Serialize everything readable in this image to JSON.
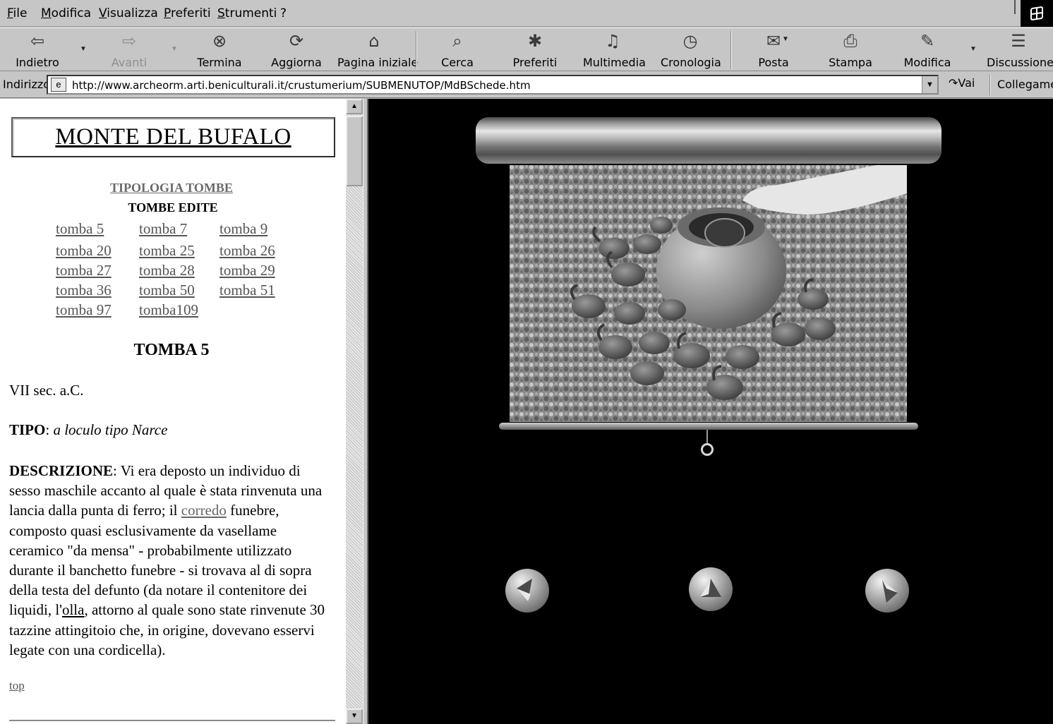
{
  "browser": {
    "menu": [
      "File",
      "Modifica",
      "Visualizza",
      "Preferiti",
      "Strumenti",
      "?"
    ],
    "toolbar": {
      "back": "Indietro",
      "forward": "Avanti",
      "stop": "Termina",
      "refresh": "Aggiorna",
      "home": "Pagina iniziale",
      "search": "Cerca",
      "favorites": "Preferiti",
      "media": "Multimedia",
      "history": "Cronologia",
      "mail": "Posta",
      "print": "Stampa",
      "edit": "Modifica",
      "discuss": "Discussione"
    },
    "address": {
      "label": "Indirizzo",
      "url": "http://www.archeorm.arti.beniculturali.it/crustumerium/SUBMENUTOP/MdBSchede.htm",
      "go": "Vai",
      "links": "Collegamenti"
    }
  },
  "page": {
    "site_title": "MONTE DEL BUFALO",
    "tipologia_link": "TIPOLOGIA TOMBE",
    "tombe_edite_heading": "TOMBE EDITE",
    "tomb_links": [
      "tomba 5",
      "tomba 7",
      "tomba 9",
      "tomba 20",
      "tomba 25",
      "tomba 26",
      "tomba 27",
      "tomba 28",
      "tomba 29",
      "tomba 36",
      "tomba 50",
      "tomba 51",
      "tomba 97",
      "tomba109"
    ],
    "section_heading": "TOMBA 5",
    "epoch": "VII sec. a.C.",
    "tipo_label": "TIPO",
    "tipo_value": "a loculo tipo Narce",
    "descrizione_label": "DESCRIZIONE",
    "descrizione_part1": ": Vi era deposto un individuo di sesso maschile accanto al quale è stata rinvenuta una lancia dalla punta di ferro; il ",
    "corredo_link": "corredo",
    "descrizione_part2": " funebre, composto quasi esclusivamente da vasellame ceramico \"da mensa\" - probabilmente utilizzato durante il banchetto funebre - si trovava al di sopra della testa del defunto  (da notare il contenitore dei liquidi, l'",
    "olla_link": "olla",
    "descrizione_part3": ", attorno al quale sono state rinvenute 30 tazzine attingitoio che, in origine, dovevano esservi legate con una cordicella).",
    "top_link": "top"
  },
  "viewer": {
    "nav_buttons": [
      "previous-arrow",
      "up-arrow",
      "next-arrow"
    ]
  },
  "colors": {
    "link": "#555555",
    "frame_bg": "#000000",
    "chrome": "#c6c6c6"
  }
}
